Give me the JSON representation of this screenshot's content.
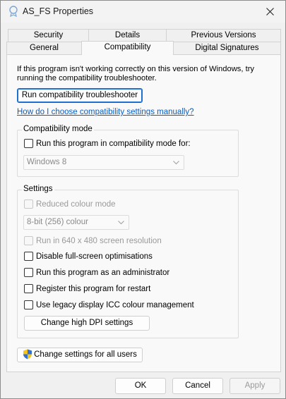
{
  "window": {
    "title": "AS_FS Properties"
  },
  "tabs_row1": [
    {
      "label": "Security"
    },
    {
      "label": "Details"
    },
    {
      "label": "Previous Versions"
    }
  ],
  "tabs_row2": [
    {
      "label": "General"
    },
    {
      "label": "Compatibility"
    },
    {
      "label": "Digital Signatures"
    }
  ],
  "intro": {
    "text": "If this program isn't working correctly on this version of Windows, try running the compatibility troubleshooter."
  },
  "troubleshooter_button": "Run compatibility troubleshooter",
  "manual_link": "How do I choose compatibility settings manually?",
  "compat_mode": {
    "title": "Compatibility mode",
    "checkbox_label": "Run this program in compatibility mode for:",
    "select_value": "Windows 8"
  },
  "settings": {
    "title": "Settings",
    "reduced_colour": "Reduced colour mode",
    "colour_select": "8-bit (256) colour",
    "resolution": "Run in 640 x 480 screen resolution",
    "fullscreen": "Disable full-screen optimisations",
    "admin": "Run this program as an administrator",
    "restart": "Register this program for restart",
    "icc": "Use legacy display ICC colour management",
    "dpi_button": "Change high DPI settings"
  },
  "all_users_button": "Change settings for all users",
  "footer": {
    "ok": "OK",
    "cancel": "Cancel",
    "apply": "Apply"
  },
  "colors": {
    "link": "#0a5ec2",
    "focus_border": "#1e6fd0",
    "disabled_text": "#9a9a9a"
  }
}
